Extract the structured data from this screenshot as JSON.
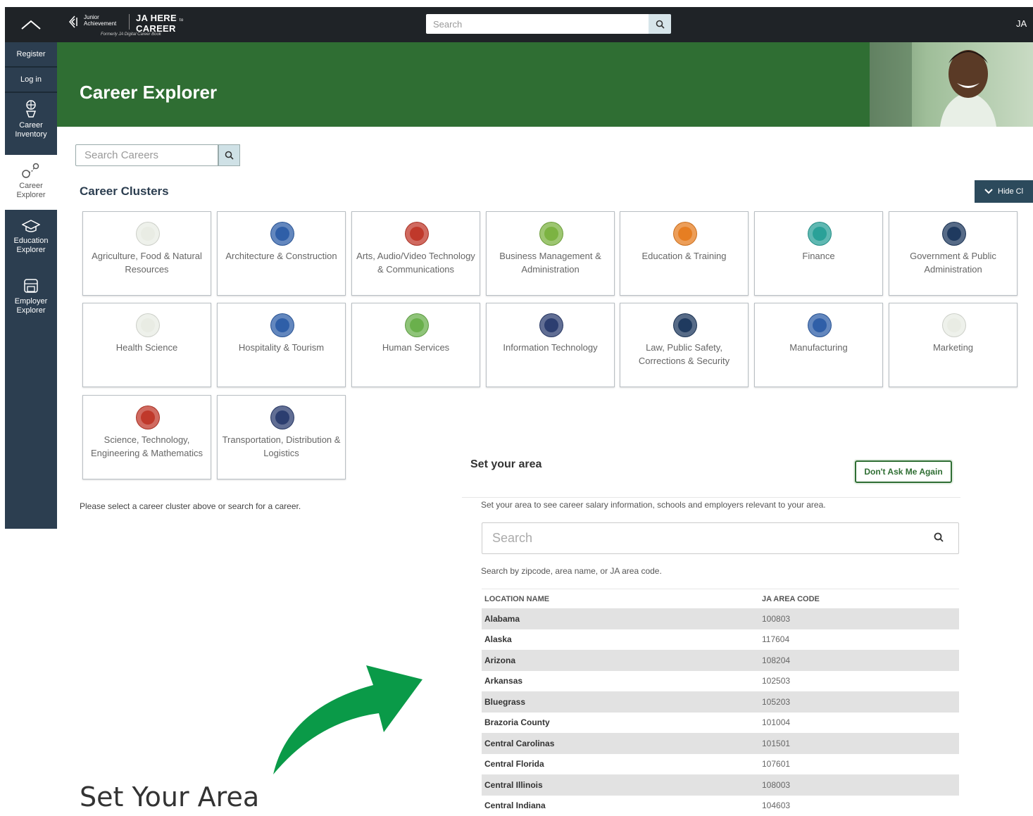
{
  "topbar": {
    "logo_ja_line1": "Junior",
    "logo_ja_line2": "Achievement",
    "logo_title_line1": "JA HERE",
    "logo_title_to": "to",
    "logo_title_line2": "CAREER",
    "logo_subtitle": "Formerly JA Digital Career Book",
    "search_placeholder": "Search",
    "user_initials": "JA"
  },
  "sidebar": {
    "register_label": "Register",
    "login_label": "Log in",
    "items": [
      {
        "label_line1": "Career",
        "label_line2": "Inventory",
        "icon": "career-inventory-icon"
      },
      {
        "label_line1": "Career",
        "label_line2": "Explorer",
        "icon": "career-explorer-icon"
      },
      {
        "label_line1": "Education",
        "label_line2": "Explorer",
        "icon": "graduation-cap-icon"
      },
      {
        "label_line1": "Employer",
        "label_line2": "Explorer",
        "icon": "storefront-icon"
      }
    ]
  },
  "banner": {
    "title": "Career Explorer"
  },
  "career_search": {
    "placeholder": "Search Careers"
  },
  "clusters": {
    "title": "Career Clusters",
    "hide_label": "Hide Cl",
    "items": [
      {
        "label": "Agriculture, Food & Natural Resources",
        "color": "#e9ece4"
      },
      {
        "label": "Architecture & Construction",
        "color": "#2f5fa8"
      },
      {
        "label": "Arts, Audio/Video Technology & Communications",
        "color": "#c0392b"
      },
      {
        "label": "Business Management & Administration",
        "color": "#7cb342"
      },
      {
        "label": "Education & Training",
        "color": "#e67e22"
      },
      {
        "label": "Finance",
        "color": "#2aa198"
      },
      {
        "label": "Government & Public Administration",
        "color": "#1f3a5f"
      },
      {
        "label": "Health Science",
        "color": "#e9ece4"
      },
      {
        "label": "Hospitality & Tourism",
        "color": "#2f5fa8"
      },
      {
        "label": "Human Services",
        "color": "#6ab04c"
      },
      {
        "label": "Information Technology",
        "color": "#2c3e70"
      },
      {
        "label": "Law, Public Safety, Corrections & Security",
        "color": "#1f3a5f"
      },
      {
        "label": "Manufacturing",
        "color": "#2f5fa8"
      },
      {
        "label": "Marketing",
        "color": "#e9ece4"
      },
      {
        "label": "Science, Technology, Engineering & Mathematics",
        "color": "#c0392b"
      },
      {
        "label": "Transportation, Distribution & Logistics",
        "color": "#2c3e70"
      }
    ],
    "note": "Please select a career cluster above or search for a career."
  },
  "set_area": {
    "title": "Set your area",
    "dont_ask_label": "Don't Ask Me Again",
    "description": "Set your area to see career salary information, schools and employers relevant to your area.",
    "search_placeholder": "Search",
    "hint": "Search by zipcode, area name, or JA area code.",
    "columns": [
      "LOCATION NAME",
      "JA AREA CODE"
    ],
    "rows": [
      [
        "Alabama",
        "100803"
      ],
      [
        "Alaska",
        "117604"
      ],
      [
        "Arizona",
        "108204"
      ],
      [
        "Arkansas",
        "102503"
      ],
      [
        "Bluegrass",
        "105203"
      ],
      [
        "Brazoria County",
        "101004"
      ],
      [
        "Central Carolinas",
        "101501"
      ],
      [
        "Central Florida",
        "107601"
      ],
      [
        "Central Illinois",
        "108003"
      ],
      [
        "Central Indiana",
        "104603"
      ]
    ]
  },
  "caption": "Set Your Area",
  "colors": {
    "banner_green": "#2f6e33",
    "sidebar_navy": "#2c3e50",
    "arrow_green": "#0a9a48"
  }
}
